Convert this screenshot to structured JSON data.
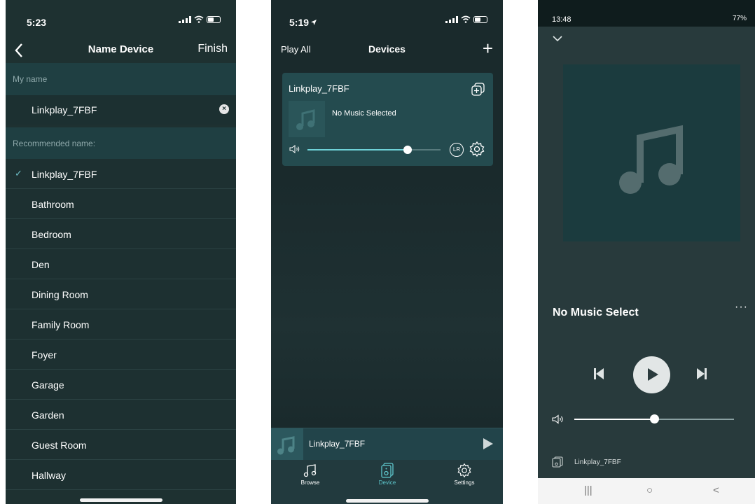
{
  "screen1": {
    "status_time": "5:23",
    "back_icon": "chevron-left-icon",
    "title": "Name Device",
    "finish_label": "Finish",
    "my_name_label": "My name",
    "name_value": "Linkplay_7FBF",
    "clear_icon": "clear-icon",
    "recommended_label": "Recommended name:",
    "recommended": [
      {
        "label": "Linkplay_7FBF",
        "selected": true
      },
      {
        "label": "Bathroom",
        "selected": false
      },
      {
        "label": "Bedroom",
        "selected": false
      },
      {
        "label": "Den",
        "selected": false
      },
      {
        "label": "Dining Room",
        "selected": false
      },
      {
        "label": "Family Room",
        "selected": false
      },
      {
        "label": "Foyer",
        "selected": false
      },
      {
        "label": "Garage",
        "selected": false
      },
      {
        "label": "Garden",
        "selected": false
      },
      {
        "label": "Guest Room",
        "selected": false
      },
      {
        "label": "Hallway",
        "selected": false
      }
    ]
  },
  "screen2": {
    "status_time": "5:19",
    "play_all_label": "Play All",
    "title": "Devices",
    "add_label": "+",
    "device": {
      "name": "Linkplay_7FBF",
      "now_playing": "No Music Selected",
      "volume": 0.75,
      "lr_label": "LR"
    },
    "mini_player": {
      "name": "Linkplay_7FBF"
    },
    "tabs": [
      {
        "label": "Browse",
        "icon": "music-note-icon",
        "active": false
      },
      {
        "label": "Device",
        "icon": "speaker-icon",
        "active": true
      },
      {
        "label": "Settings",
        "icon": "gear-icon",
        "active": false
      }
    ],
    "accent_color": "#5fc9cf"
  },
  "screen3": {
    "status_time": "13:48",
    "status_right": "77%",
    "song_title": "No Music Select",
    "more_label": "···",
    "volume": 0.5,
    "device_name": "Linkplay_7FBF",
    "android_nav": {
      "recents": "|||",
      "home": "○",
      "back": "<"
    }
  }
}
